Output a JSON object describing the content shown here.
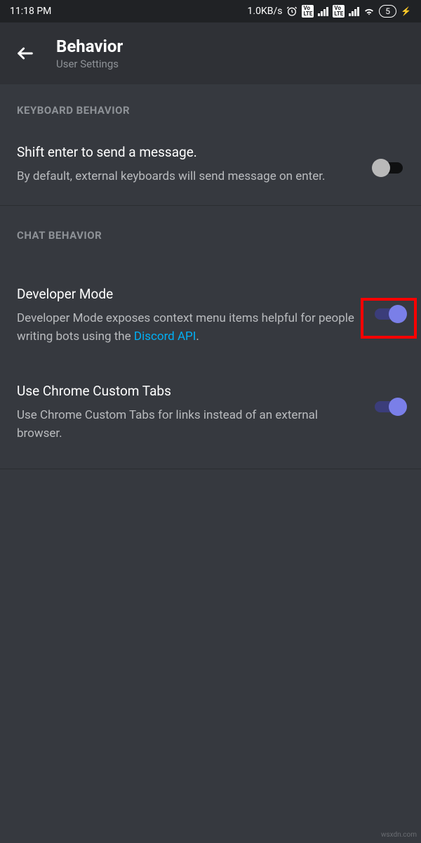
{
  "statusBar": {
    "time": "11:18 PM",
    "network": "1.0KB/s",
    "battery": "5"
  },
  "header": {
    "title": "Behavior",
    "subtitle": "User Settings"
  },
  "sections": {
    "keyboard": {
      "header": "KEYBOARD BEHAVIOR",
      "shiftEnter": {
        "title": "Shift enter to send a message.",
        "desc": "By default, external keyboards will send message on enter.",
        "enabled": false
      }
    },
    "chat": {
      "header": "CHAT BEHAVIOR",
      "devMode": {
        "title": "Developer Mode",
        "descPrefix": "Developer Mode exposes context menu items helpful for people writing bots using the ",
        "linkText": "Discord API",
        "descSuffix": ".",
        "enabled": true
      },
      "chromeTabs": {
        "title": "Use Chrome Custom Tabs",
        "desc": "Use Chrome Custom Tabs for links instead of an external browser.",
        "enabled": true
      }
    }
  },
  "watermark": "wsxdn.com"
}
